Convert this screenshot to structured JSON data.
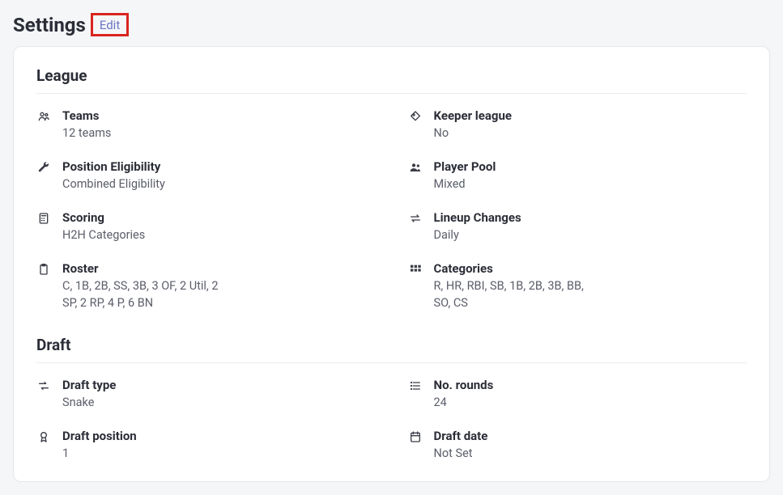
{
  "header": {
    "title": "Settings",
    "edit_label": "Edit"
  },
  "sections": {
    "league": {
      "title": "League",
      "items": {
        "teams": {
          "label": "Teams",
          "value": "12 teams"
        },
        "keeper": {
          "label": "Keeper league",
          "value": "No"
        },
        "position_eligibility": {
          "label": "Position Eligibility",
          "value": "Combined Eligibility"
        },
        "player_pool": {
          "label": "Player Pool",
          "value": "Mixed"
        },
        "scoring": {
          "label": "Scoring",
          "value": "H2H Categories"
        },
        "lineup_changes": {
          "label": "Lineup Changes",
          "value": "Daily"
        },
        "roster": {
          "label": "Roster",
          "value": "C, 1B, 2B, SS, 3B, 3 OF, 2 Util, 2 SP, 2 RP, 4 P, 6 BN"
        },
        "categories": {
          "label": "Categories",
          "value": "R, HR, RBI, SB, 1B, 2B, 3B, BB, SO, CS"
        }
      }
    },
    "draft": {
      "title": "Draft",
      "items": {
        "draft_type": {
          "label": "Draft type",
          "value": "Snake"
        },
        "no_rounds": {
          "label": "No. rounds",
          "value": "24"
        },
        "draft_position": {
          "label": "Draft position",
          "value": "1"
        },
        "draft_date": {
          "label": "Draft date",
          "value": "Not Set"
        }
      }
    }
  }
}
